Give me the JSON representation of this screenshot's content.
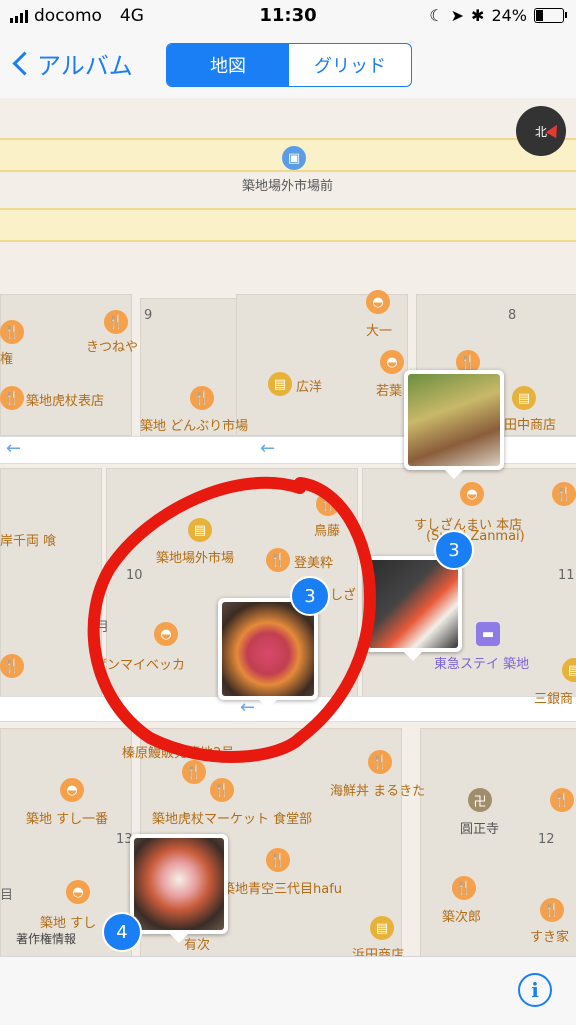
{
  "status": {
    "carrier": "docomo",
    "network": "4G",
    "time": "11:30",
    "battery": "24%",
    "battery_level": 0.24
  },
  "nav": {
    "back_label": "アルバム",
    "segments": [
      "地図",
      "グリッド"
    ],
    "active_segment": "地図"
  },
  "map": {
    "compass_label": "北",
    "bus_stop": "築地場外市場前",
    "block_numbers": [
      "9",
      "8",
      "10",
      "11",
      "13",
      "12",
      "月",
      "目"
    ],
    "places": {
      "kitsuneya": "きつねや",
      "toratoraomote": "築地虎杖表店",
      "donburi": "築地 どんぶり市場",
      "koyo": "広洋",
      "daiichi": "大一",
      "wakaba": "若葉",
      "tanaka": "田中商店",
      "kishisenryo": "岸千両 喰",
      "jogai": "築地場外市場",
      "torifuji": "鳥藤",
      "tomisui": "登美粋",
      "shiza": "しざ",
      "sushizanmai": "すしざんまい 本店",
      "sushizanmai_en": "(Sushi Zanmai)",
      "kyutei": "東急ステイ 築地",
      "mitsuwa": "三銀商",
      "zanmai_bekkan": "ザンマイベッカ",
      "enohara": "榛原鰻販売築地2号",
      "kaisendon": "海鮮丼 まるきた",
      "sushiichiban": "築地 すし一番",
      "market_shokudo": "築地虎杖マーケット 食堂部",
      "enshoji": "圓正寺",
      "aozora": "築地青空三代目hafu",
      "tsukijiro": "築次郎",
      "sukiya": "すき家",
      "sushi_short": "築地 すし",
      "yuji": "有次",
      "hamada": "浜田商店",
      "ryo": "権"
    },
    "photo_counts": [
      "3",
      "3",
      "4"
    ]
  },
  "legal_label": "著作権情報",
  "toolbar": {
    "info_icon": "i"
  },
  "colors": {
    "accent": "#1a7ef5",
    "poi": "#f5a04a",
    "annotation": "#e8190f"
  }
}
